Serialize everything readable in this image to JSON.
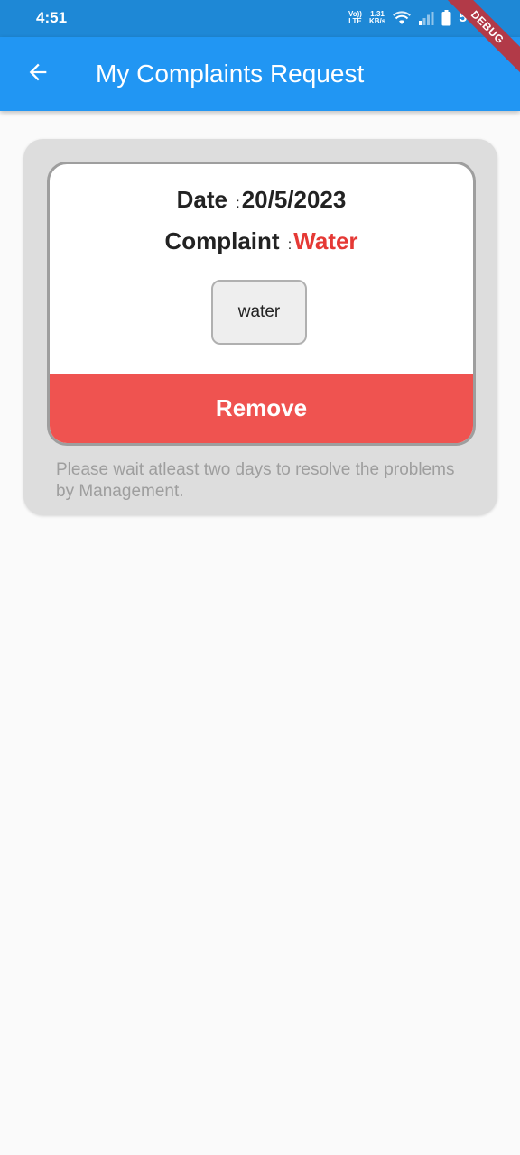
{
  "status_bar": {
    "time": "4:51",
    "network_label_top": "Vo))",
    "network_label_bottom": "LTE",
    "speed_value": "1.31",
    "speed_unit": "KB/s",
    "battery": "56",
    "debug_label": "DEBUG"
  },
  "app_bar": {
    "title": "My Complaints Request",
    "back_icon": "arrow-left-icon",
    "color": "#2196f3"
  },
  "complaint": {
    "date_label": "Date",
    "date_separator": ":",
    "date_value": "20/5/2023",
    "type_label": "Complaint",
    "type_separator": ":",
    "type_value": "Water",
    "type_color": "#e53935",
    "description": "water",
    "remove_label": "Remove",
    "remove_color": "#ef5350",
    "note": "Please wait atleast two days to resolve the problems by Management."
  }
}
